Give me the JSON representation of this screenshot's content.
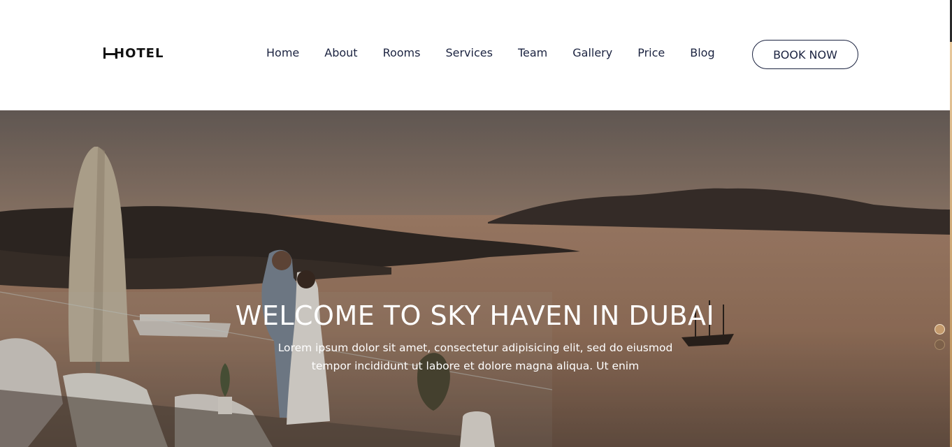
{
  "brand": {
    "logo_text": "HOTEL",
    "logo_icon": "bed-icon"
  },
  "nav": {
    "items": [
      {
        "label": "Home"
      },
      {
        "label": "About"
      },
      {
        "label": "Rooms"
      },
      {
        "label": "Services"
      },
      {
        "label": "Team"
      },
      {
        "label": "Gallery"
      },
      {
        "label": "Price"
      },
      {
        "label": "Blog"
      }
    ],
    "cta_label": "BOOK NOW"
  },
  "hero": {
    "title": "WELCOME TO SKY HAVEN IN DUBAI",
    "subtitle_line1": "Lorem ipsum dolor sit amet, consectetur adipisicing elit, sed do eiusmod",
    "subtitle_line2": "tempor incididunt ut labore et dolore magna aliqua. Ut enim",
    "slides": {
      "count": 2,
      "active": 1
    }
  },
  "colors": {
    "accent": "#c49a6c",
    "nav_text": "#1b2340",
    "header_bg": "#ffffff"
  }
}
